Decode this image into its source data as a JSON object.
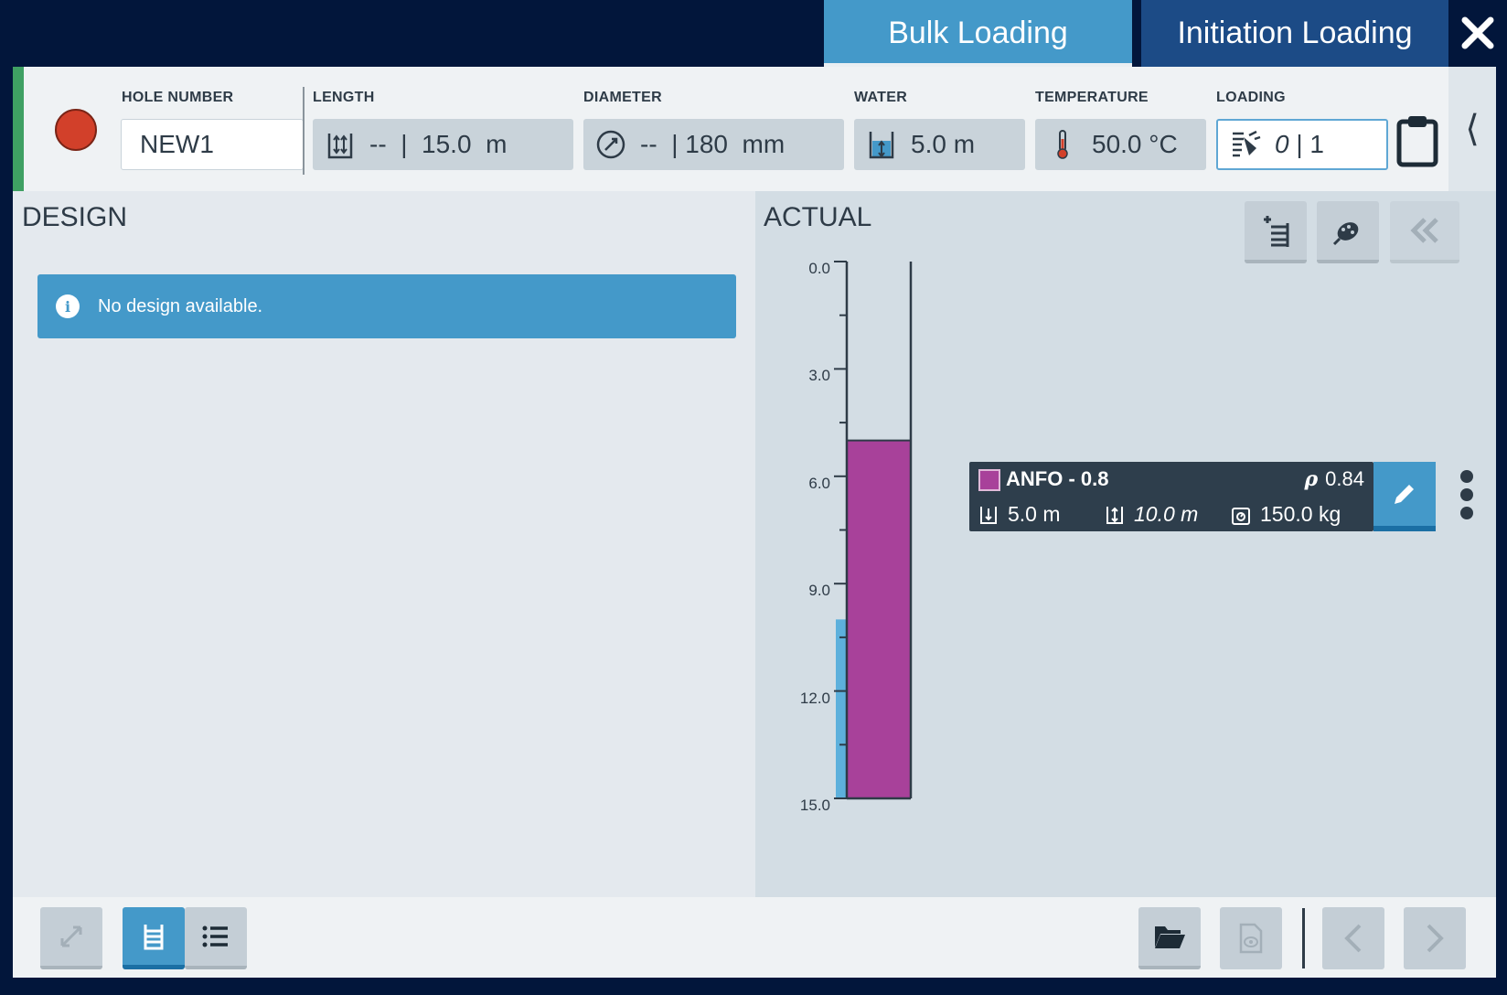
{
  "tabs": {
    "bulk": "Bulk Loading",
    "initiation": "Initiation Loading"
  },
  "header": {
    "status_color": "#d2402a",
    "hole_number": {
      "label": "HOLE NUMBER",
      "value": "NEW1"
    },
    "length": {
      "label": "LENGTH",
      "value": "--  |  15.0  m",
      "icon": "length-icon"
    },
    "diameter": {
      "label": "DIAMETER",
      "value": "--  | 180  mm",
      "icon": "diameter-icon"
    },
    "water": {
      "label": "WATER",
      "value": "5.0 m",
      "icon": "water-icon"
    },
    "temperature": {
      "label": "TEMPERATURE",
      "value": "50.0 °C",
      "icon": "thermometer-icon"
    },
    "loading": {
      "label": "LOADING",
      "value_italic": "0",
      "value_rest": " | 1",
      "icon": "loading-icon"
    }
  },
  "design": {
    "title": "DESIGN",
    "info_message": "No design available."
  },
  "actual": {
    "title": "ACTUAL",
    "axis_ticks": [
      "0.0",
      "3.0",
      "6.0",
      "9.0",
      "12.0",
      "15.0"
    ],
    "hole_depth_m": 15.0,
    "water_depth_m": 5.0,
    "deck": {
      "name": "ANFO - 0.8",
      "rho_symbol": "ρ",
      "density": "0.84",
      "color": "#a8419a",
      "top": "5.0 m",
      "length": "10.0 m",
      "mass": "150.0 kg",
      "top_m": 5.0,
      "bottom_m": 15.0
    }
  }
}
